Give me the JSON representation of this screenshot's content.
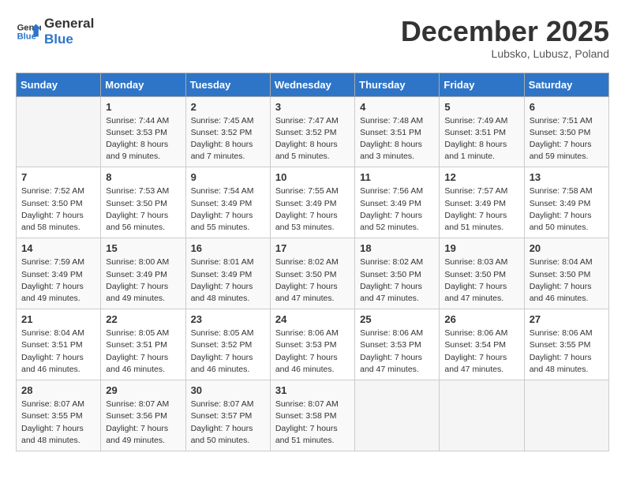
{
  "header": {
    "logo_line1": "General",
    "logo_line2": "Blue",
    "month_title": "December 2025",
    "subtitle": "Lubsko, Lubusz, Poland"
  },
  "weekdays": [
    "Sunday",
    "Monday",
    "Tuesday",
    "Wednesday",
    "Thursday",
    "Friday",
    "Saturday"
  ],
  "weeks": [
    [
      {
        "day": "",
        "info": ""
      },
      {
        "day": "1",
        "info": "Sunrise: 7:44 AM\nSunset: 3:53 PM\nDaylight: 8 hours\nand 9 minutes."
      },
      {
        "day": "2",
        "info": "Sunrise: 7:45 AM\nSunset: 3:52 PM\nDaylight: 8 hours\nand 7 minutes."
      },
      {
        "day": "3",
        "info": "Sunrise: 7:47 AM\nSunset: 3:52 PM\nDaylight: 8 hours\nand 5 minutes."
      },
      {
        "day": "4",
        "info": "Sunrise: 7:48 AM\nSunset: 3:51 PM\nDaylight: 8 hours\nand 3 minutes."
      },
      {
        "day": "5",
        "info": "Sunrise: 7:49 AM\nSunset: 3:51 PM\nDaylight: 8 hours\nand 1 minute."
      },
      {
        "day": "6",
        "info": "Sunrise: 7:51 AM\nSunset: 3:50 PM\nDaylight: 7 hours\nand 59 minutes."
      }
    ],
    [
      {
        "day": "7",
        "info": "Sunrise: 7:52 AM\nSunset: 3:50 PM\nDaylight: 7 hours\nand 58 minutes."
      },
      {
        "day": "8",
        "info": "Sunrise: 7:53 AM\nSunset: 3:50 PM\nDaylight: 7 hours\nand 56 minutes."
      },
      {
        "day": "9",
        "info": "Sunrise: 7:54 AM\nSunset: 3:49 PM\nDaylight: 7 hours\nand 55 minutes."
      },
      {
        "day": "10",
        "info": "Sunrise: 7:55 AM\nSunset: 3:49 PM\nDaylight: 7 hours\nand 53 minutes."
      },
      {
        "day": "11",
        "info": "Sunrise: 7:56 AM\nSunset: 3:49 PM\nDaylight: 7 hours\nand 52 minutes."
      },
      {
        "day": "12",
        "info": "Sunrise: 7:57 AM\nSunset: 3:49 PM\nDaylight: 7 hours\nand 51 minutes."
      },
      {
        "day": "13",
        "info": "Sunrise: 7:58 AM\nSunset: 3:49 PM\nDaylight: 7 hours\nand 50 minutes."
      }
    ],
    [
      {
        "day": "14",
        "info": "Sunrise: 7:59 AM\nSunset: 3:49 PM\nDaylight: 7 hours\nand 49 minutes."
      },
      {
        "day": "15",
        "info": "Sunrise: 8:00 AM\nSunset: 3:49 PM\nDaylight: 7 hours\nand 49 minutes."
      },
      {
        "day": "16",
        "info": "Sunrise: 8:01 AM\nSunset: 3:49 PM\nDaylight: 7 hours\nand 48 minutes."
      },
      {
        "day": "17",
        "info": "Sunrise: 8:02 AM\nSunset: 3:50 PM\nDaylight: 7 hours\nand 47 minutes."
      },
      {
        "day": "18",
        "info": "Sunrise: 8:02 AM\nSunset: 3:50 PM\nDaylight: 7 hours\nand 47 minutes."
      },
      {
        "day": "19",
        "info": "Sunrise: 8:03 AM\nSunset: 3:50 PM\nDaylight: 7 hours\nand 47 minutes."
      },
      {
        "day": "20",
        "info": "Sunrise: 8:04 AM\nSunset: 3:50 PM\nDaylight: 7 hours\nand 46 minutes."
      }
    ],
    [
      {
        "day": "21",
        "info": "Sunrise: 8:04 AM\nSunset: 3:51 PM\nDaylight: 7 hours\nand 46 minutes."
      },
      {
        "day": "22",
        "info": "Sunrise: 8:05 AM\nSunset: 3:51 PM\nDaylight: 7 hours\nand 46 minutes."
      },
      {
        "day": "23",
        "info": "Sunrise: 8:05 AM\nSunset: 3:52 PM\nDaylight: 7 hours\nand 46 minutes."
      },
      {
        "day": "24",
        "info": "Sunrise: 8:06 AM\nSunset: 3:53 PM\nDaylight: 7 hours\nand 46 minutes."
      },
      {
        "day": "25",
        "info": "Sunrise: 8:06 AM\nSunset: 3:53 PM\nDaylight: 7 hours\nand 47 minutes."
      },
      {
        "day": "26",
        "info": "Sunrise: 8:06 AM\nSunset: 3:54 PM\nDaylight: 7 hours\nand 47 minutes."
      },
      {
        "day": "27",
        "info": "Sunrise: 8:06 AM\nSunset: 3:55 PM\nDaylight: 7 hours\nand 48 minutes."
      }
    ],
    [
      {
        "day": "28",
        "info": "Sunrise: 8:07 AM\nSunset: 3:55 PM\nDaylight: 7 hours\nand 48 minutes."
      },
      {
        "day": "29",
        "info": "Sunrise: 8:07 AM\nSunset: 3:56 PM\nDaylight: 7 hours\nand 49 minutes."
      },
      {
        "day": "30",
        "info": "Sunrise: 8:07 AM\nSunset: 3:57 PM\nDaylight: 7 hours\nand 50 minutes."
      },
      {
        "day": "31",
        "info": "Sunrise: 8:07 AM\nSunset: 3:58 PM\nDaylight: 7 hours\nand 51 minutes."
      },
      {
        "day": "",
        "info": ""
      },
      {
        "day": "",
        "info": ""
      },
      {
        "day": "",
        "info": ""
      }
    ]
  ]
}
